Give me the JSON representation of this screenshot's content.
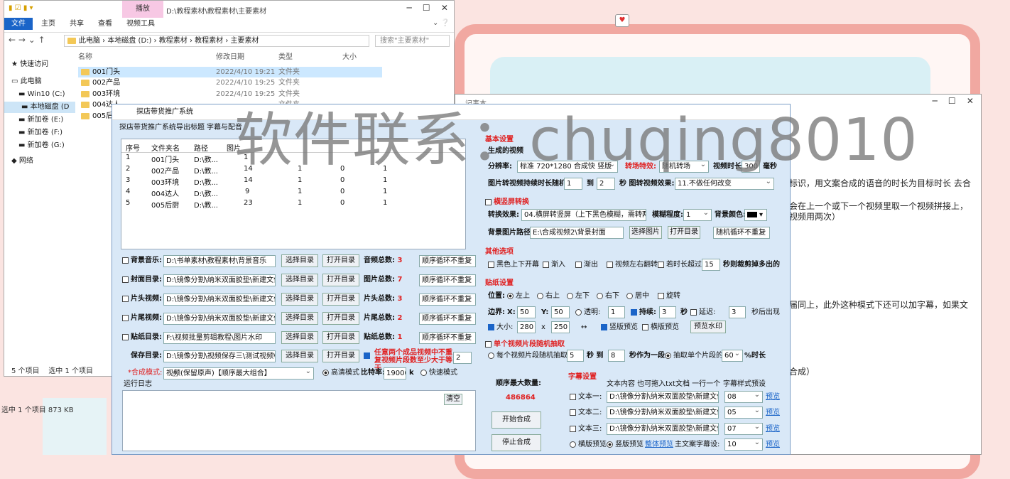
{
  "explorer": {
    "title": "D:\\教程素材\\教程素材\\主要素材",
    "ribbon_play": "播放",
    "tabs": [
      "文件",
      "主页",
      "共享",
      "查看",
      "视频工具"
    ],
    "address": [
      "此电脑",
      "本地磁盘 (D:)",
      "教程素材",
      "教程素材",
      "主要素材"
    ],
    "search_placeholder": "搜索\"主要素材\"",
    "columns": [
      "名称",
      "修改日期",
      "类型",
      "大小"
    ],
    "rows": [
      {
        "name": "001门头",
        "date": "2022/4/10 19:21",
        "type": "文件夹"
      },
      {
        "name": "002产品",
        "date": "2022/4/10 19:25",
        "type": "文件夹"
      },
      {
        "name": "003环境",
        "date": "2022/4/10 19:25",
        "type": "文件夹"
      },
      {
        "name": "004达人",
        "date": "",
        "type": "文件夹"
      },
      {
        "name": "005后厨",
        "date": "",
        "type": ""
      }
    ],
    "nav": [
      "快速访问",
      "此电脑",
      "Win10 (C:)",
      "本地磁盘 (D",
      "新加卷 (E:)",
      "新加卷 (F:)",
      "新加卷 (G:)",
      "网络"
    ],
    "status_items": "5 个项目",
    "status_selected": "选中 1 个项目",
    "status_bottom": "选中 1 个项目  873 KB"
  },
  "notepad": {
    "title": "记事本",
    "lines": [
      "标识，用文案合成的语音的时长为目标时长 去合",
      "会在上一个或下一个视频里取一个视频拼接上，",
      "视频用两次）",
      "届同上，此外这种模式下还可以加字幕，如果文",
      "合成）"
    ]
  },
  "dialog": {
    "title": "探店带货推广系统",
    "menu": [
      "探店带货推广系统",
      "导出标题",
      "字幕与配音"
    ],
    "grid_columns": [
      "序号",
      "文件夹名",
      "路径",
      "图片"
    ],
    "grid_rows": [
      {
        "n": "1",
        "name": "001门头",
        "path": "D:\\教...",
        "c1": "1",
        "c2": "",
        "c3": "",
        "c4": ""
      },
      {
        "n": "2",
        "name": "002产品",
        "path": "D:\\教...",
        "c1": "14",
        "c2": "1",
        "c3": "0",
        "c4": "1"
      },
      {
        "n": "3",
        "name": "003环境",
        "path": "D:\\教...",
        "c1": "14",
        "c2": "1",
        "c3": "0",
        "c4": "1"
      },
      {
        "n": "4",
        "name": "004达人",
        "path": "D:\\教...",
        "c1": "9",
        "c2": "1",
        "c3": "0",
        "c4": "1"
      },
      {
        "n": "5",
        "name": "005后厨",
        "path": "D:\\教...",
        "c1": "23",
        "c2": "1",
        "c3": "0",
        "c4": "1"
      }
    ],
    "materials": [
      {
        "label": "背景音乐:",
        "path": "D:\\书单素材\\教程素材\\背景音乐",
        "total_label": "音频总数:",
        "total": "3",
        "mode": "顺序循环不重复"
      },
      {
        "label": "封面目录:",
        "path": "D:\\镜像分割\\纳米双面胶垫\\新建文件夹",
        "total_label": "图片总数:",
        "total": "7",
        "mode": "顺序循环不重复"
      },
      {
        "label": "片头视频:",
        "path": "D:\\镜像分割\\纳米双面胶垫\\新建文件夹",
        "total_label": "片头总数:",
        "total": "3",
        "mode": "顺序循环不重复"
      },
      {
        "label": "片尾视频:",
        "path": "D:\\镜像分割\\纳米双面胶垫\\新建文件夹",
        "total_label": "片尾总数:",
        "total": "2",
        "mode": "顺序循环不重复"
      },
      {
        "label": "贴纸目录:",
        "path": "F:\\视频批量剪辑教程\\图片水印",
        "total_label": "贴纸总数:",
        "total": "1",
        "mode": "顺序循环不重复"
      }
    ],
    "btn_choose": "选择目录",
    "btn_open": "打开目录",
    "save_label": "保存目录:",
    "save_path": "D:\\镜像分割\\视频保存三\\测试视频\\040",
    "save_note": "任意两个成品视频中不重复视频片段数至少大于等于",
    "save_note_value": "2",
    "mode_label": "*合成模式:",
    "mode_value": "视频(保留原声)【顺序最大组合】",
    "hd_mode": "高清模式",
    "bitrate_label": "比特率:",
    "bitrate": "19000",
    "bitrate_unit": "k",
    "fast_mode": "快速模式",
    "log_label": "运行日志",
    "clear": "清空",
    "right": {
      "heading": "基本设置",
      "sub_heading": "生成的视频",
      "res_label": "分辨率:",
      "res_value": "标准 720*1280 合成快 竖版",
      "trans_label": "转场特效:",
      "trans_value": "随机转场",
      "dur_label": "视频时长:",
      "dur_value": "300",
      "dur_unit": "毫秒",
      "img_rand_label": "图片转视频持续时长随机:",
      "img_rand_a": "1",
      "img_rand_to": "到",
      "img_rand_b": "2",
      "img_effect_label": "秒 图转视频效果:",
      "img_effect": "11.不做任何改变",
      "landscape_heading": "横竖屏转换",
      "conv_label": "转换效果:",
      "conv_value": "04.横屏转竖屏（上下黑色模糊，需转两次）",
      "blur_label": "模糊程度:",
      "blur_value": "1",
      "bgcolor_label": "背景颜色:",
      "bgimg_label": "背景图片路径:",
      "bgimg_value": "E:\\合成视频2\\背景封面",
      "choose_img": "选择图片",
      "open_dir": "打开目录",
      "bg_mode": "随机循环不重复",
      "other_heading": "其他选项",
      "other_opts": [
        "黑色上下开幕",
        "渐入",
        "渐出",
        "视频左右翻转",
        "若时长超过"
      ],
      "over_value": "15",
      "over_suffix": "秒则裁剪掉多出的",
      "sticker_heading": "贴纸设置",
      "pos_label": "位置:",
      "positions": [
        "左上",
        "右上",
        "左下",
        "右下",
        "居中",
        "旋转"
      ],
      "margin_label": "边界:",
      "x_label": "X:",
      "x_value": "50",
      "y_label": "Y:",
      "y_value": "50",
      "opacity_label": "透明:",
      "opacity_value": "1",
      "keep_label": "持续:",
      "keep_value": "3",
      "sec": "秒",
      "delay_label": "延迟:",
      "delay_value": "3",
      "delay_suffix": "秒后出现",
      "size_label": "大小:",
      "w_value": "280",
      "times": "x",
      "h_value": "250",
      "arrows": "↔",
      "v_preview": "竖版预览",
      "h_preview": "横版预览",
      "preview_wm": "预览水印",
      "clip_heading": "单个视频片段随机抽取",
      "clip_each": "每个视频片段随机抽取",
      "clip_a": "5",
      "clip_to": "秒 到",
      "clip_b": "8",
      "clip_unit": "秒作为一段",
      "clip_pct_label": "抽取单个片段的",
      "clip_pct": "60",
      "clip_pct_suffix": "%时长",
      "max_label": "顺序最大数量:",
      "max_value": "486864",
      "start": "开始合成",
      "stop": "停止合成",
      "sub_heading2": "字幕设置",
      "sub_desc": "文本内容 也可拖入txt文档 一行一个",
      "sub_style_label": "字幕样式预设",
      "texts": [
        {
          "label": "文本一:",
          "path": "D:\\镜像分割\\纳米双面胶垫\\新建文件夹",
          "style": "08"
        },
        {
          "label": "文本二:",
          "path": "D:\\镜像分割\\纳米双面胶垫\\新建文件夹",
          "style": "05"
        },
        {
          "label": "文本三:",
          "path": "D:\\镜像分割\\纳米双面胶垫\\新建文件夹",
          "style": "07"
        }
      ],
      "preview_link": "预览",
      "landscape_preview": "横版预览",
      "portrait_preview": "竖版预览",
      "whole_preview": "整体预览",
      "main_style_label": "主文案字幕设:",
      "main_style": "10"
    }
  },
  "watermark": "软件联系：chuqing8010"
}
